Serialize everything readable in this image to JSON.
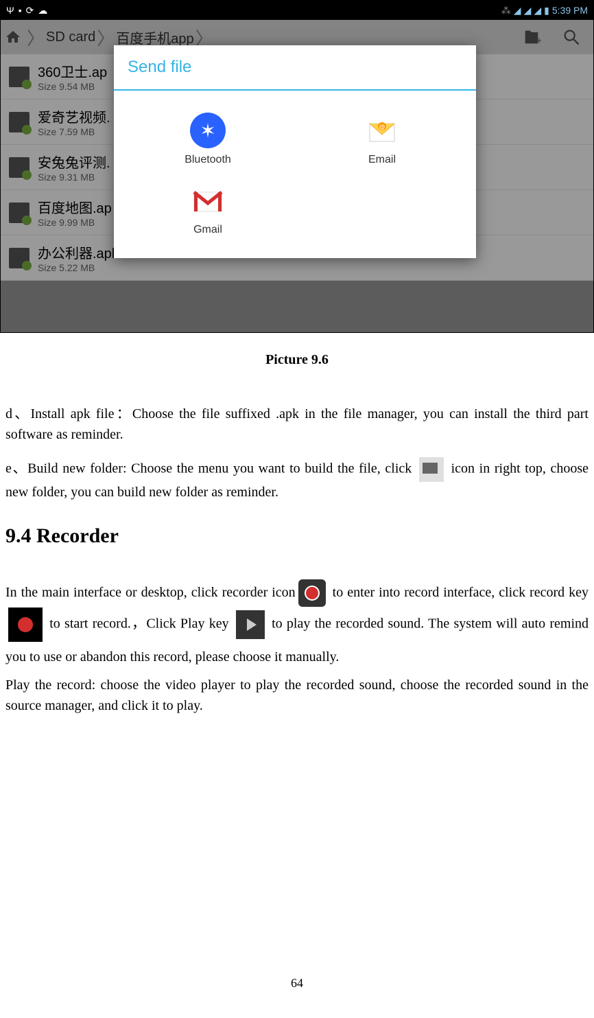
{
  "status_bar": {
    "time": "5:39 PM"
  },
  "breadcrumb": {
    "item1": "SD card",
    "item2": "百度手机app"
  },
  "files": [
    {
      "name": "360卫士.ap",
      "size": "Size 9.54 MB"
    },
    {
      "name": "爱奇艺视频.",
      "size": "Size 7.59 MB"
    },
    {
      "name": "安兔兔评测.",
      "size": "Size 9.31 MB"
    },
    {
      "name": "百度地图.ap",
      "size": "Size 9.99 MB"
    },
    {
      "name": "办公利器.apk",
      "size": "Size 5.22 MB"
    }
  ],
  "dialog": {
    "title": "Send file",
    "options": [
      {
        "label": "Bluetooth"
      },
      {
        "label": "Email"
      },
      {
        "label": "Gmail"
      }
    ]
  },
  "caption": "Picture 9.6",
  "para_d": "d、Install apk file：Choose the file suffixed .apk in the file manager, you can install the third part software as reminder.",
  "para_e_1": "e、Build new folder: Choose the menu you want to build the file, click ",
  "para_e_2": " icon in right top, choose new folder, you can build new folder as reminder.",
  "heading": "9.4 Recorder",
  "rec_1": "In the main interface or desktop, click recorder icon",
  "rec_2": " to enter into record interface, click record key ",
  "rec_3": " to start record.，Click Play key ",
  "rec_4": " to play the recorded sound. The system will auto remind you to use or abandon this record, please choose it manually.",
  "rec_play": "Play the record: choose the video player to play the recorded sound, choose the recorded sound in the source manager, and click it to play.",
  "page_num": "64"
}
